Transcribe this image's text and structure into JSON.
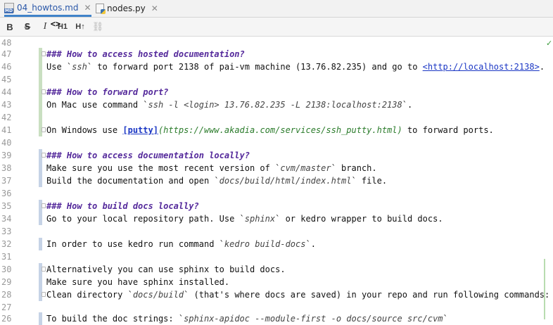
{
  "tabs": [
    {
      "label": "04_howtos.md",
      "icon": "markdown-file-icon",
      "active": true,
      "close": "✕"
    },
    {
      "label": "nodes.py",
      "icon": "python-file-icon",
      "active": false,
      "close": "✕"
    }
  ],
  "toolbar": {
    "bold": "B",
    "strike": "S",
    "italic": "I",
    "code": "<>",
    "h1": "H1",
    "h2": "H↑",
    "link": "⛓"
  },
  "colors": {
    "header": "#54299b",
    "url": "#1a36c4",
    "link_url": "#2a7b2a",
    "vcs_added": "#c9dfc1",
    "vcs_modified": "#c6d3e6"
  },
  "editor": {
    "lines": [
      {
        "n": "48"
      },
      {
        "n": "47",
        "text": "### How to access hosted documentation?"
      },
      {
        "n": "46",
        "a": "Use `",
        "b": "ssh",
        "c": "` to forward port 2138 of pai-vm machine (13.76.82.235) and go to ",
        "d": "<http://localhost:2138>",
        "e": "."
      },
      {
        "n": "45"
      },
      {
        "n": "44",
        "text": "### How to forward port?"
      },
      {
        "n": "43",
        "a": "On Mac use command `",
        "b": "ssh -l <login> 13.76.82.235 -L 2138:localhost:2138",
        "c": "`."
      },
      {
        "n": "42"
      },
      {
        "n": "41",
        "a": "On Windows use ",
        "b": "[putty]",
        "c": "(https://www.akadia.com/services/ssh_putty.html)",
        "d": " to forward ports."
      },
      {
        "n": "40"
      },
      {
        "n": "39",
        "text": "### How to access documentation locally?"
      },
      {
        "n": "38",
        "a": "Make sure you use the most recent version of `",
        "b": "cvm/master",
        "c": "` branch."
      },
      {
        "n": "37",
        "a": "Build the documentation and open `",
        "b": "docs/build/html/index.html",
        "c": "` file."
      },
      {
        "n": "36"
      },
      {
        "n": "35",
        "text": "### How to build docs locally?"
      },
      {
        "n": "34",
        "a": "Go to your local repository path. Use `",
        "b": "sphinx",
        "c": "` or kedro wrapper to build docs."
      },
      {
        "n": "33"
      },
      {
        "n": "32",
        "a": "In order to use kedro run command `",
        "b": "kedro build-docs",
        "c": "`."
      },
      {
        "n": "31"
      },
      {
        "n": "30",
        "text": "Alternatively you can use sphinx to build docs."
      },
      {
        "n": "29",
        "text": "Make sure you have sphinx installed."
      },
      {
        "n": "28",
        "a": "Clean directory `",
        "b": "docs/build",
        "c": "` (that's where docs are saved) in your repo and run following commands:"
      },
      {
        "n": "27"
      },
      {
        "n": "26",
        "a": "To build the doc strings: `",
        "b": "sphinx-apidoc --module-first -o docs/source src/cvm",
        "c": "`"
      }
    ]
  }
}
